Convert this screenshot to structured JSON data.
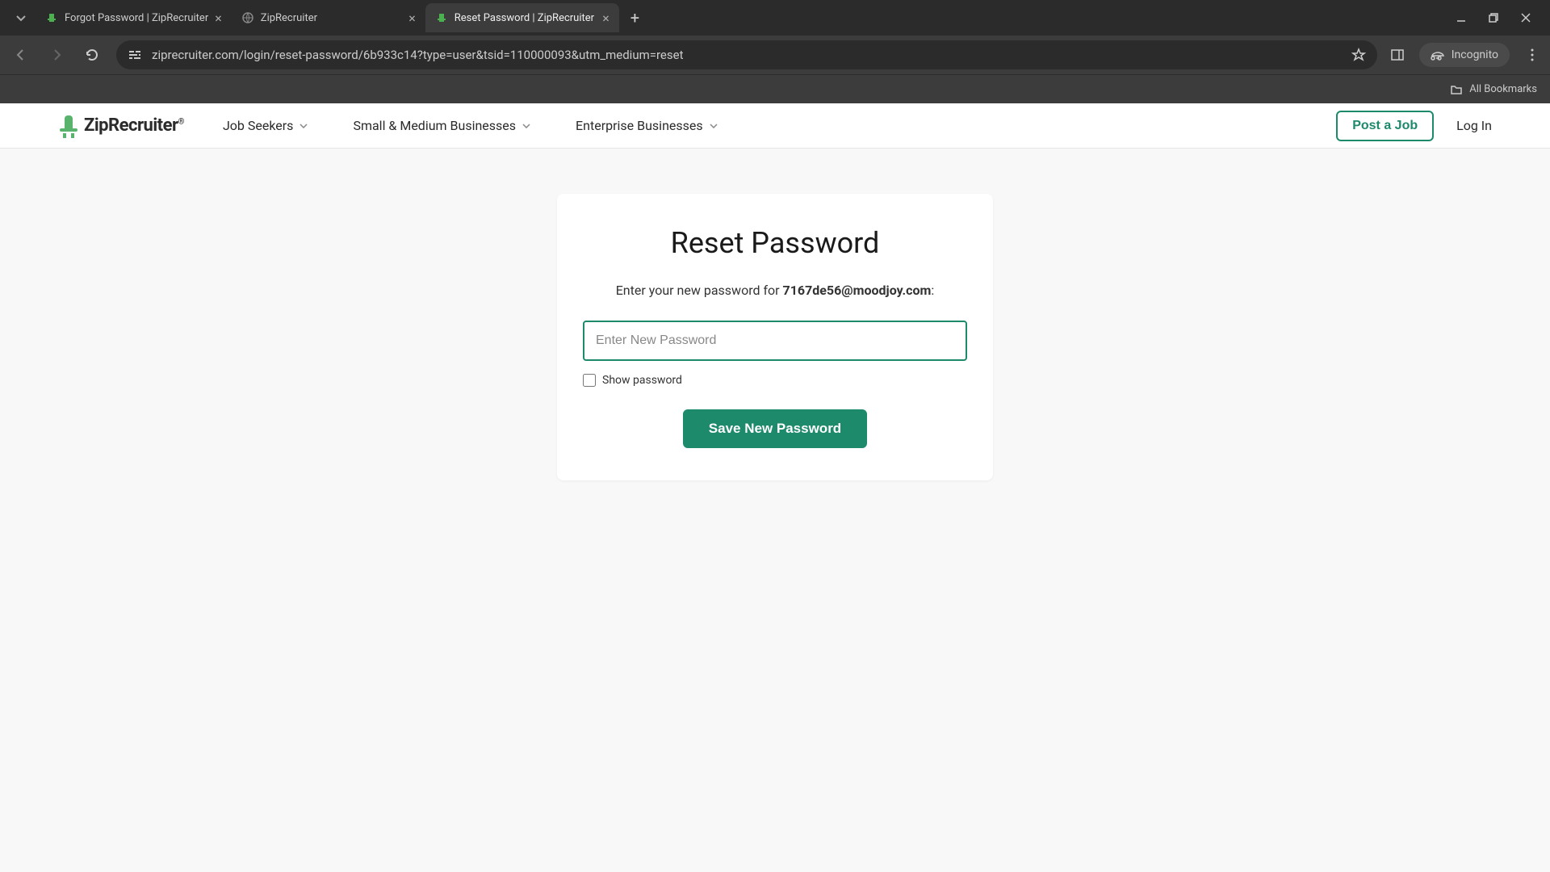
{
  "browser": {
    "tabs": [
      {
        "title": "Forgot Password | ZipRecruiter",
        "active": false,
        "favicon": "green"
      },
      {
        "title": "ZipRecruiter",
        "active": false,
        "favicon": "gray"
      },
      {
        "title": "Reset Password | ZipRecruiter",
        "active": true,
        "favicon": "green"
      }
    ],
    "url": "ziprecruiter.com/login/reset-password/6b933c14?type=user&tsid=110000093&utm_medium=reset",
    "incognito_label": "Incognito",
    "bookmarks_label": "All Bookmarks"
  },
  "site_nav": {
    "logo": "ZipRecruiter",
    "links": [
      {
        "label": "Job Seekers"
      },
      {
        "label": "Small & Medium Businesses"
      },
      {
        "label": "Enterprise Businesses"
      }
    ],
    "post_job": "Post a Job",
    "login": "Log In"
  },
  "card": {
    "title": "Reset Password",
    "subtitle_prefix": "Enter your new password for ",
    "email": "7167de56@moodjoy.com",
    "subtitle_suffix": ":",
    "password_placeholder": "Enter New Password",
    "show_password_label": "Show password",
    "save_button": "Save New Password"
  }
}
